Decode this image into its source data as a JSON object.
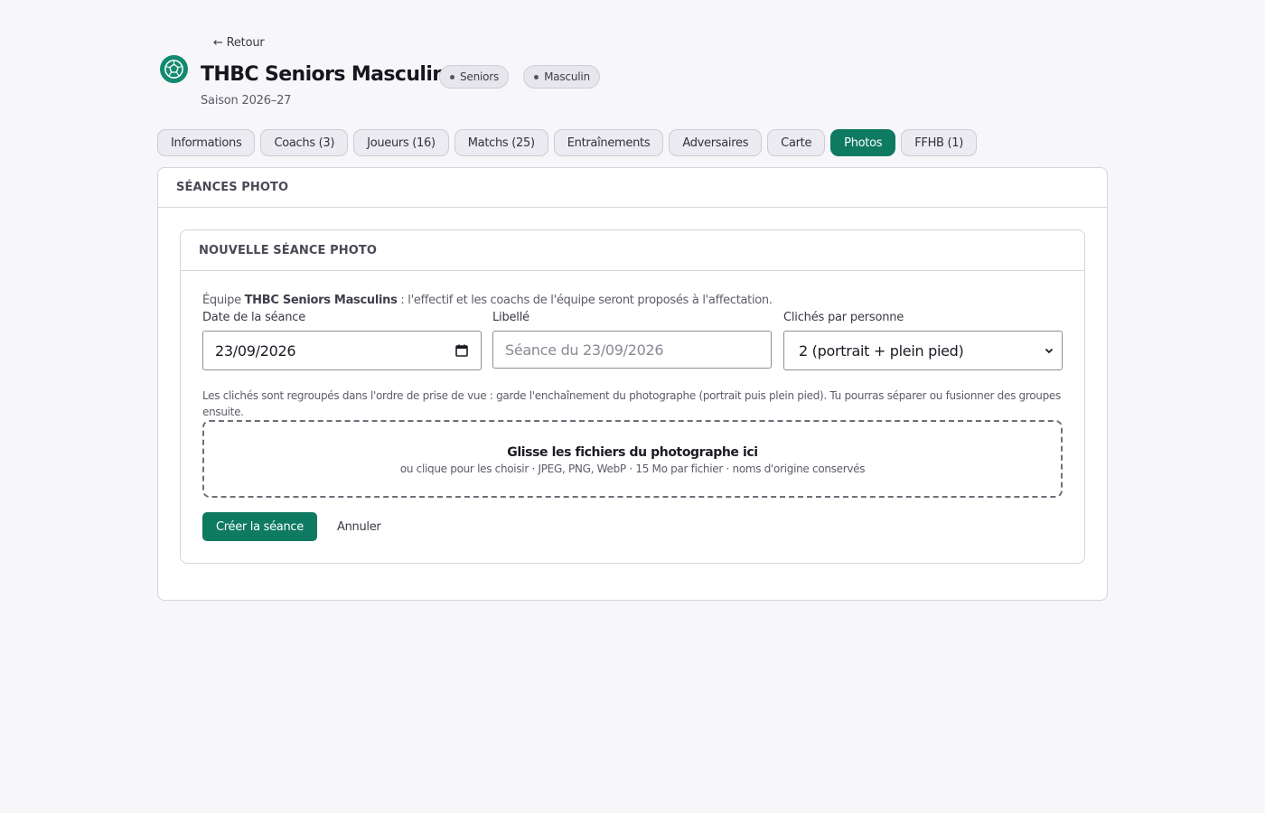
{
  "header": {
    "back_label": "← Retour",
    "title": "THBC Seniors Masculins",
    "badges": [
      "Seniors",
      "Masculin"
    ],
    "season": "Saison 2026–27",
    "accent_color": "#0f7a62"
  },
  "tabs": [
    {
      "label": "Informations"
    },
    {
      "label": "Coachs (3)"
    },
    {
      "label": "Joueurs (16)"
    },
    {
      "label": "Matchs (25)"
    },
    {
      "label": "Entraînements"
    },
    {
      "label": "Adversaires"
    },
    {
      "label": "Carte"
    },
    {
      "label": "Photos",
      "active": true
    },
    {
      "label": "FFHB (1)"
    }
  ],
  "panel": {
    "title": "SÉANCES PHOTO",
    "card": {
      "title": "NOUVELLE SÉANCE PHOTO",
      "intro_prefix": "Équipe ",
      "intro_team": "THBC Seniors Masculins",
      "intro_suffix": " : l'effectif et les coachs de l'équipe seront proposés à l'affectation.",
      "date_label": "Date de la séance",
      "date_value": "23/09/2026",
      "libelle_label": "Libellé",
      "libelle_placeholder": "Séance du 23/09/2026",
      "cliches_label": "Clichés par personne",
      "cliches_value": "2 (portrait + plein pied)",
      "hint": "Les clichés sont regroupés dans l'ordre de prise de vue : garde l'enchaînement du photographe (portrait puis plein pied). Tu pourras séparer ou fusionner des groupes ensuite.",
      "dropzone_title": "Glisse les fichiers du photographe ici",
      "dropzone_sub": "ou clique pour les choisir · JPEG, PNG, WebP · 15 Mo par fichier · noms d'origine conservés",
      "create_label": "Créer la séance",
      "cancel_label": "Annuler"
    }
  }
}
